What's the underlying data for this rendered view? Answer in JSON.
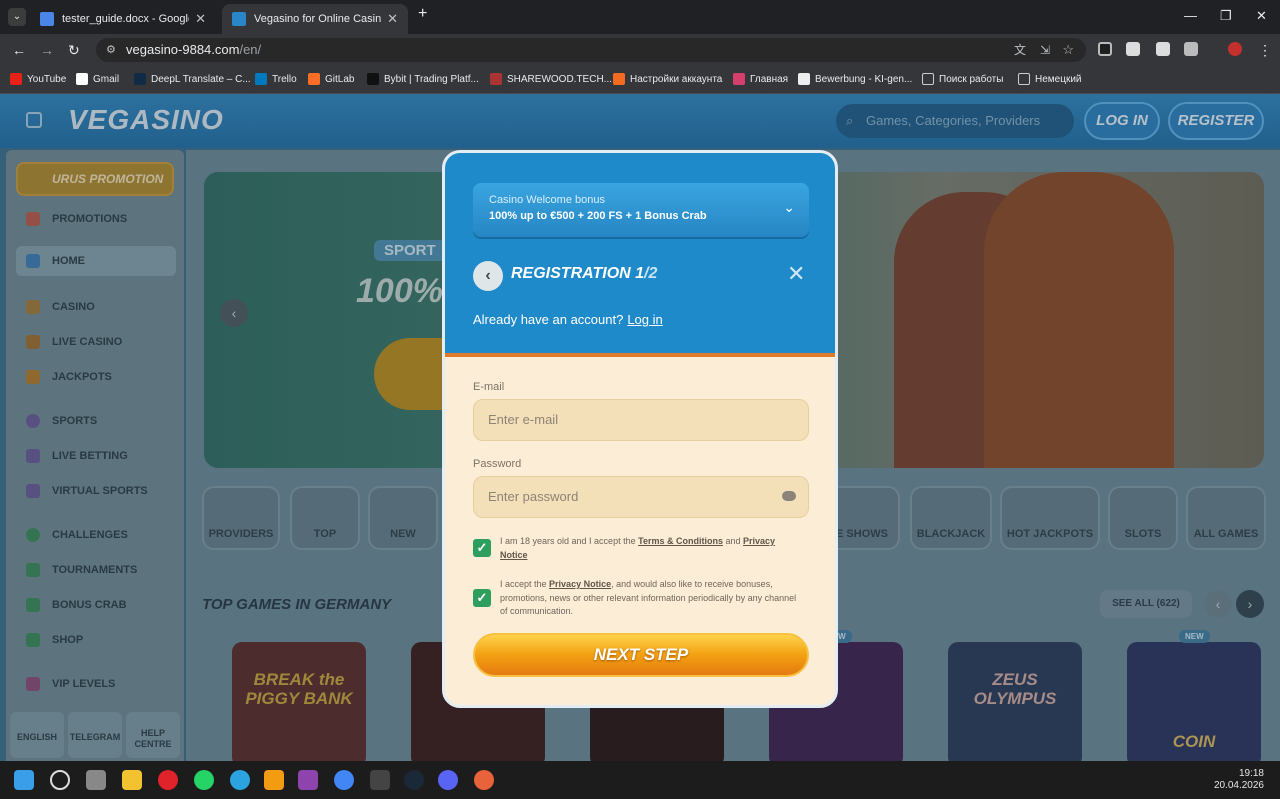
{
  "browser": {
    "tabs": [
      {
        "title": "tester_guide.docx - Google Док",
        "active": false
      },
      {
        "title": "Vegasino for Online Casino and",
        "active": true
      }
    ],
    "url_host": "vegasino-9884.com",
    "url_path": "/en/",
    "bookmarks": [
      "YouTube",
      "Gmail",
      "DeepL Translate – C...",
      "Trello",
      "GitLab",
      "Bybit | Trading Platf...",
      "SHAREWOOD.TECH...",
      "Настройки аккаунта",
      "Главная",
      "Bewerbung - KI-gen...",
      "Поиск работы",
      "Немецкий"
    ]
  },
  "site": {
    "logo": "VEGASINO",
    "search_placeholder": "Games, Categories, Providers",
    "login_label": "LOG IN",
    "register_label": "REGISTER"
  },
  "sidebar": {
    "bonus_promo": "URUS PROMOTION",
    "items": [
      "PROMOTIONS",
      "HOME",
      "CASINO",
      "LIVE CASINO",
      "JACKPOTS",
      "SPORTS",
      "LIVE BETTING",
      "VIRTUAL SPORTS",
      "CHALLENGES",
      "TOURNAMENTS",
      "BONUS CRAB",
      "SHOP",
      "VIP LEVELS"
    ],
    "footer": [
      "ENGLISH",
      "TELEGRAM",
      "HELP CENTRE"
    ]
  },
  "hero": {
    "badge": "SPORT",
    "percent": "100%"
  },
  "categories": [
    "PROVIDERS",
    "TOP",
    "NEW",
    "ME SHOWS",
    "BLACKJACK",
    "HOT JACKPOTS",
    "SLOTS",
    "ALL GAMES"
  ],
  "top_games": {
    "title": "TOP GAMES IN GERMANY",
    "see_all": "SEE ALL (622)",
    "new_badge": "NEW",
    "cards": [
      "BREAK the PIGGY BANK",
      "ZEUS OLYMPUS",
      "COIN"
    ]
  },
  "modal": {
    "bonus_kicker": "Casino Welcome bonus",
    "bonus_title": "100% up to €500 + 200 FS + 1 Bonus Crab",
    "title": "REGISTRATION 1",
    "title_step": "/2",
    "have_account": "Already have an account?",
    "login_link": "Log in",
    "email_label": "E-mail",
    "email_placeholder": "Enter e-mail",
    "password_label": "Password",
    "password_placeholder": "Enter password",
    "terms_text_1": "I am 18 years old and I accept the",
    "terms_link_1": "Terms & Conditions",
    "terms_and": "and",
    "terms_link_2": "Privacy Notice",
    "consent_text_1": "I accept the",
    "consent_link": "Privacy Notice",
    "consent_text_2": ", and would also like to receive bonuses, promotions, news or other relevant information periodically by any channel of communication.",
    "next_step": "NEXT STEP"
  },
  "taskbar": {
    "time": "19:18",
    "date": "20.04.2026"
  }
}
